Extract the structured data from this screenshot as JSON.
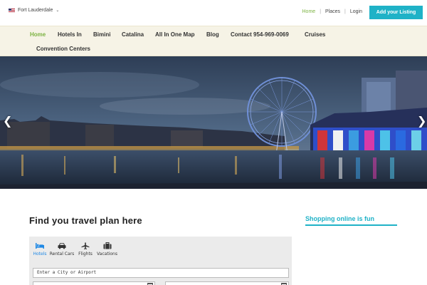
{
  "topbar": {
    "city": "Fort Lauderdale",
    "links": [
      {
        "label": "Home",
        "active": true
      },
      {
        "label": "Places",
        "active": false
      },
      {
        "label": "Login",
        "active": false
      }
    ],
    "add_listing": "Add your Listing"
  },
  "nav": {
    "items": [
      "Home",
      "Hotels In",
      "Bimini",
      "Catalina",
      "All In One Map",
      "Blog",
      "Contact 954-969-0069",
      "Cruises",
      "Convention Centers"
    ],
    "active_index": 0
  },
  "hero": {
    "prev_icon": "chevron-left-icon",
    "next_icon": "chevron-right-icon"
  },
  "main": {
    "title": "Find you travel plan here"
  },
  "sidebar": {
    "title": "Shopping online is fun"
  },
  "search_widget": {
    "tabs": [
      {
        "label": "Hotels",
        "icon": "bed-icon",
        "active": true
      },
      {
        "label": "Rental Cars",
        "icon": "car-icon",
        "active": false
      },
      {
        "label": "Flights",
        "icon": "plane-icon",
        "active": false
      },
      {
        "label": "Vacations",
        "icon": "suitcase-icon",
        "active": false
      }
    ],
    "city_placeholder": "Enter a City or Airport"
  },
  "colors": {
    "accent": "#1fb2c7",
    "nav_active": "#7cb342",
    "nav_bg": "#f6f3e6"
  }
}
